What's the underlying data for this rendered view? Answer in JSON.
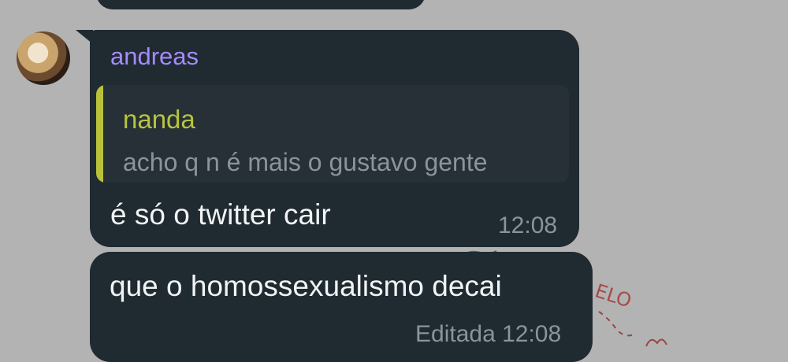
{
  "messages": [
    {
      "sender": "andreas",
      "reply": {
        "name": "nanda",
        "text": "acho q n é mais o gustavo gente"
      },
      "text": "é só o twitter cair",
      "time": "12:08"
    },
    {
      "text": "que o homossexualismo decai",
      "time": "Editada 12:08"
    }
  ],
  "wallpaper": {
    "doodle_text": "ELO"
  },
  "colors": {
    "background": "#b3b3b3",
    "bubble": "#1f2a31",
    "sender_name": "#a58bff",
    "reply_accent": "#b8c13a",
    "text": "#f1f3f4",
    "meta": "#8b949a"
  }
}
